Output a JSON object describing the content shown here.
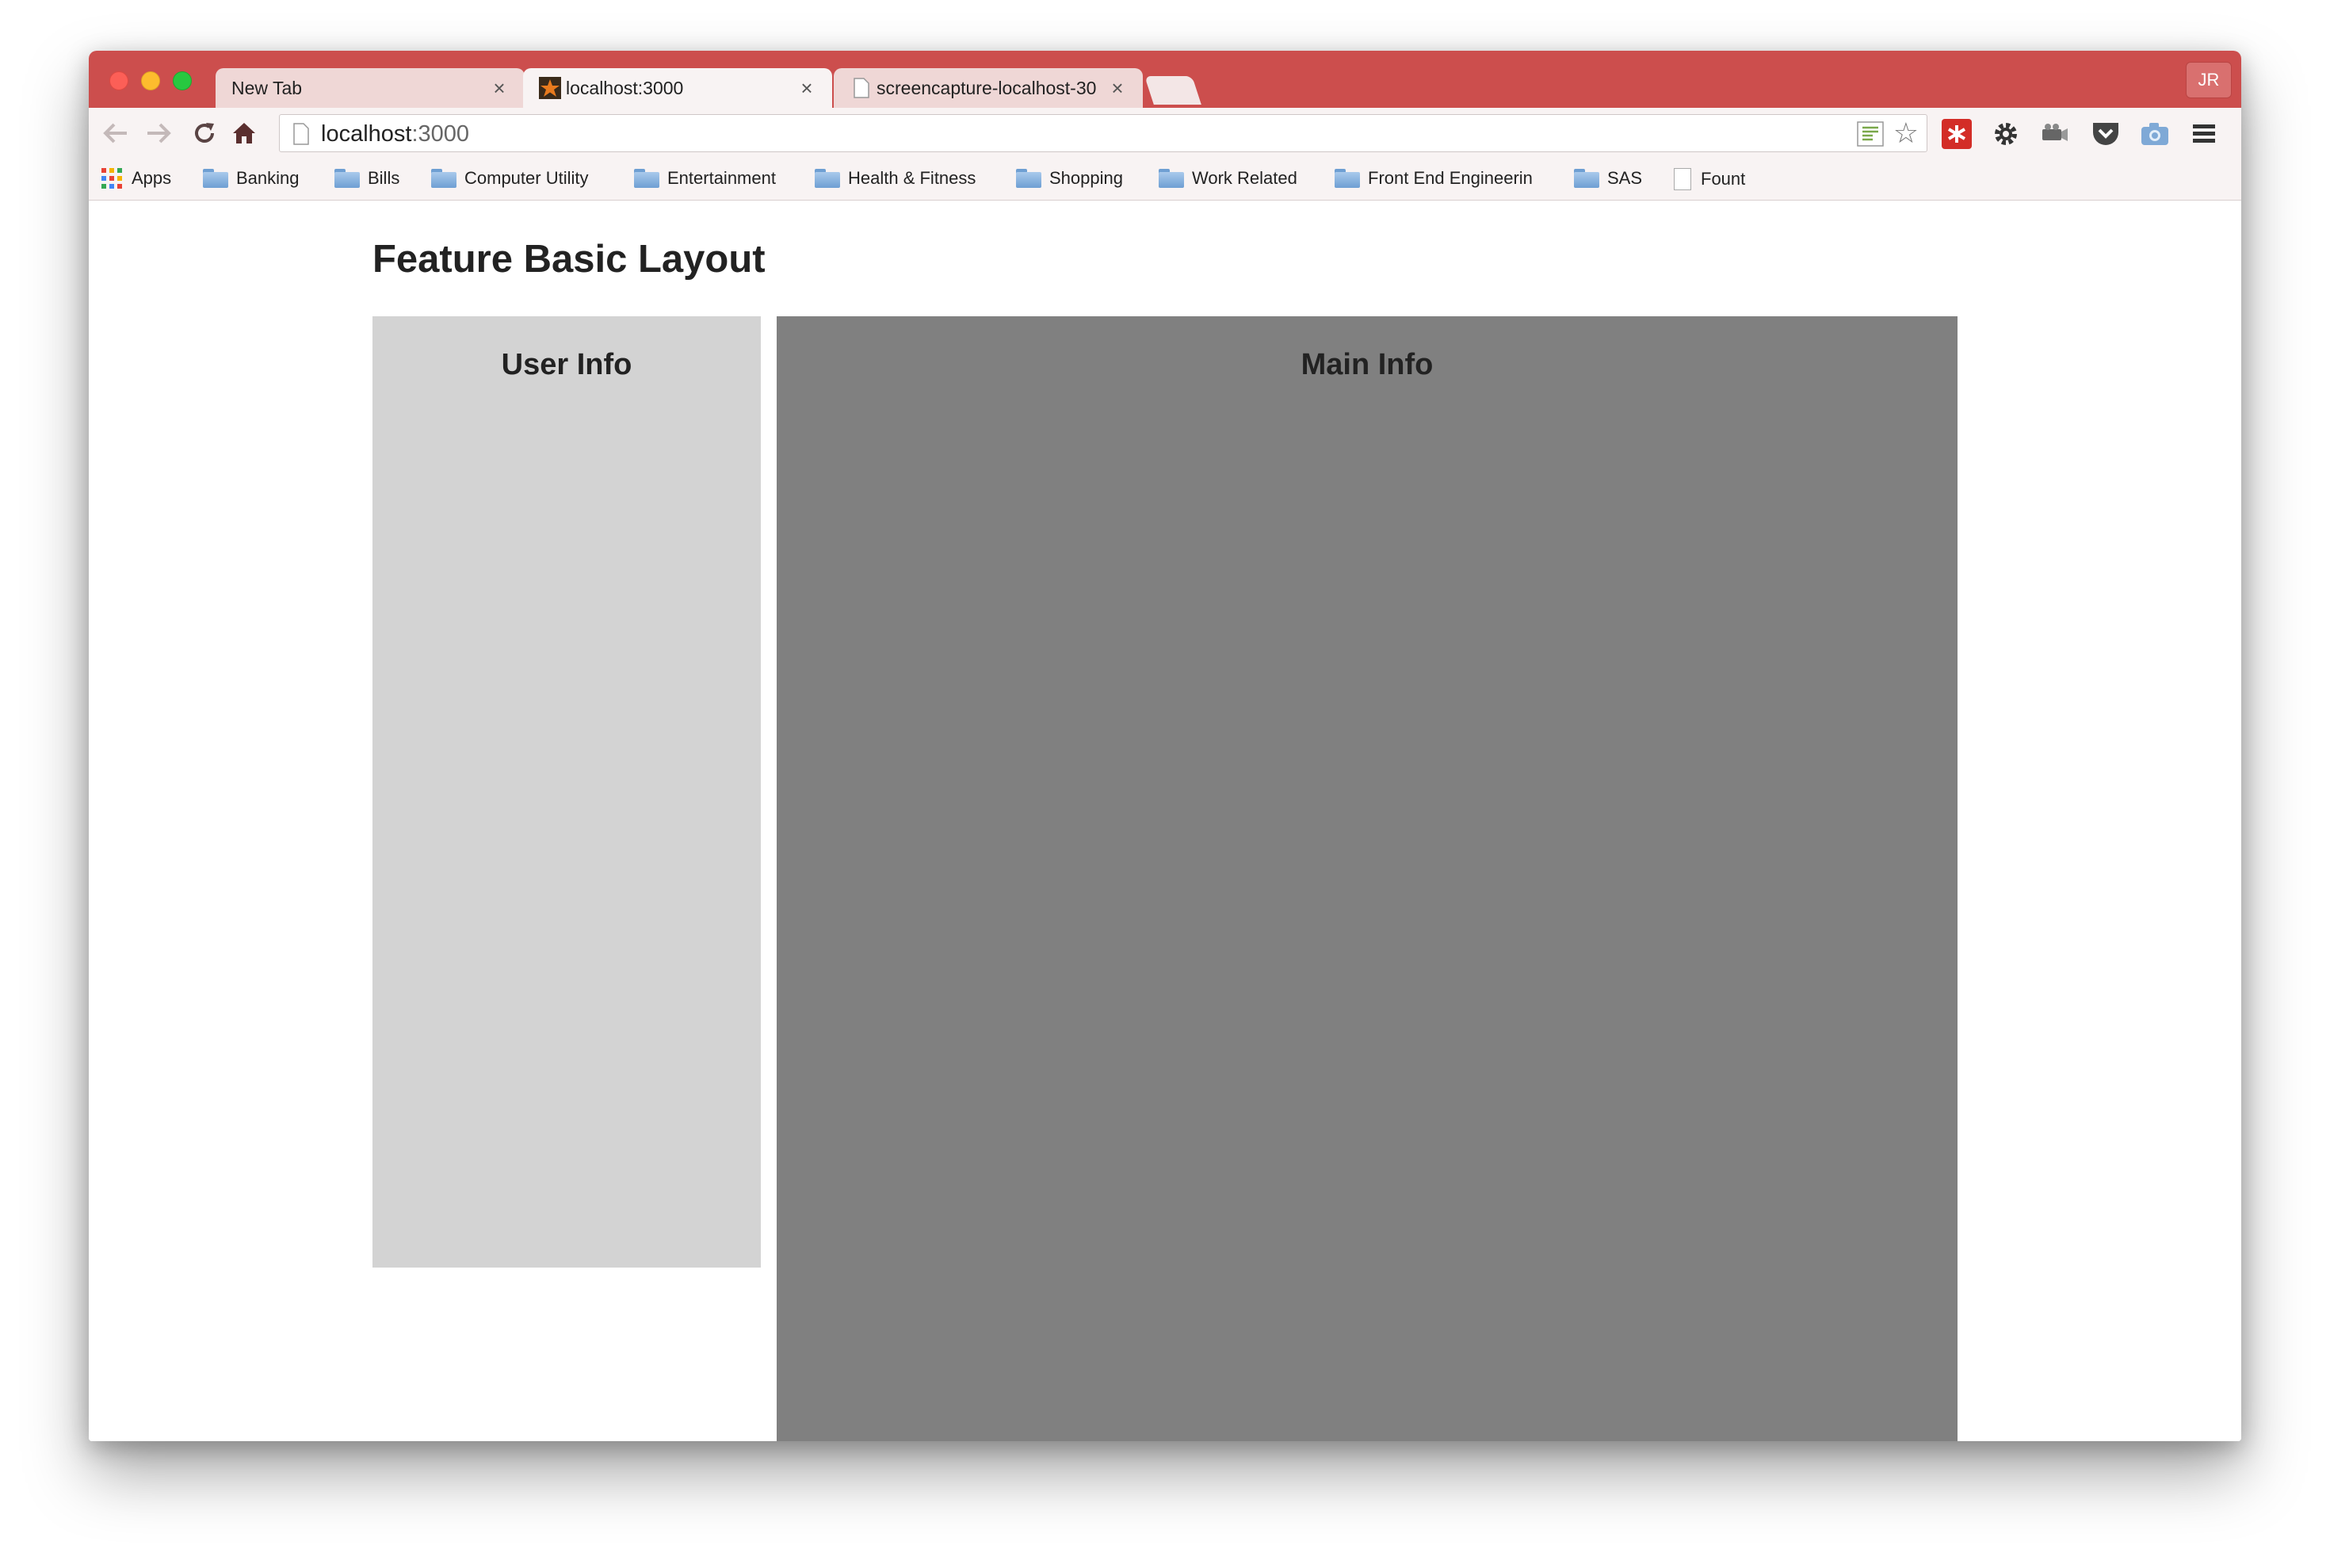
{
  "browser": {
    "tabs": [
      {
        "label": "New Tab",
        "active": false
      },
      {
        "label": "localhost:3000",
        "active": true
      },
      {
        "label": "screencapture-localhost-30",
        "active": false
      }
    ],
    "profile_initials": "JR",
    "url_host": "localhost",
    "url_port": ":3000",
    "theme_color": "#cc4e4d"
  },
  "bookmarks": [
    {
      "label": "Apps",
      "icon": "apps-grid-icon"
    },
    {
      "label": "Banking",
      "icon": "folder-icon"
    },
    {
      "label": "Bills",
      "icon": "folder-icon"
    },
    {
      "label": "Computer Utility",
      "icon": "folder-icon"
    },
    {
      "label": "Entertainment",
      "icon": "folder-icon"
    },
    {
      "label": "Health & Fitness",
      "icon": "folder-icon"
    },
    {
      "label": "Shopping",
      "icon": "folder-icon"
    },
    {
      "label": "Work Related",
      "icon": "folder-icon"
    },
    {
      "label": "Front End Engineerin",
      "icon": "folder-icon"
    },
    {
      "label": "SAS",
      "icon": "folder-icon"
    },
    {
      "label": "Fount",
      "icon": "page-icon"
    }
  ],
  "page": {
    "title": "Feature Basic Layout",
    "user_panel_heading": "User Info",
    "main_panel_heading": "Main Info",
    "user_panel_color": "#d3d3d3",
    "main_panel_color": "#808080"
  }
}
